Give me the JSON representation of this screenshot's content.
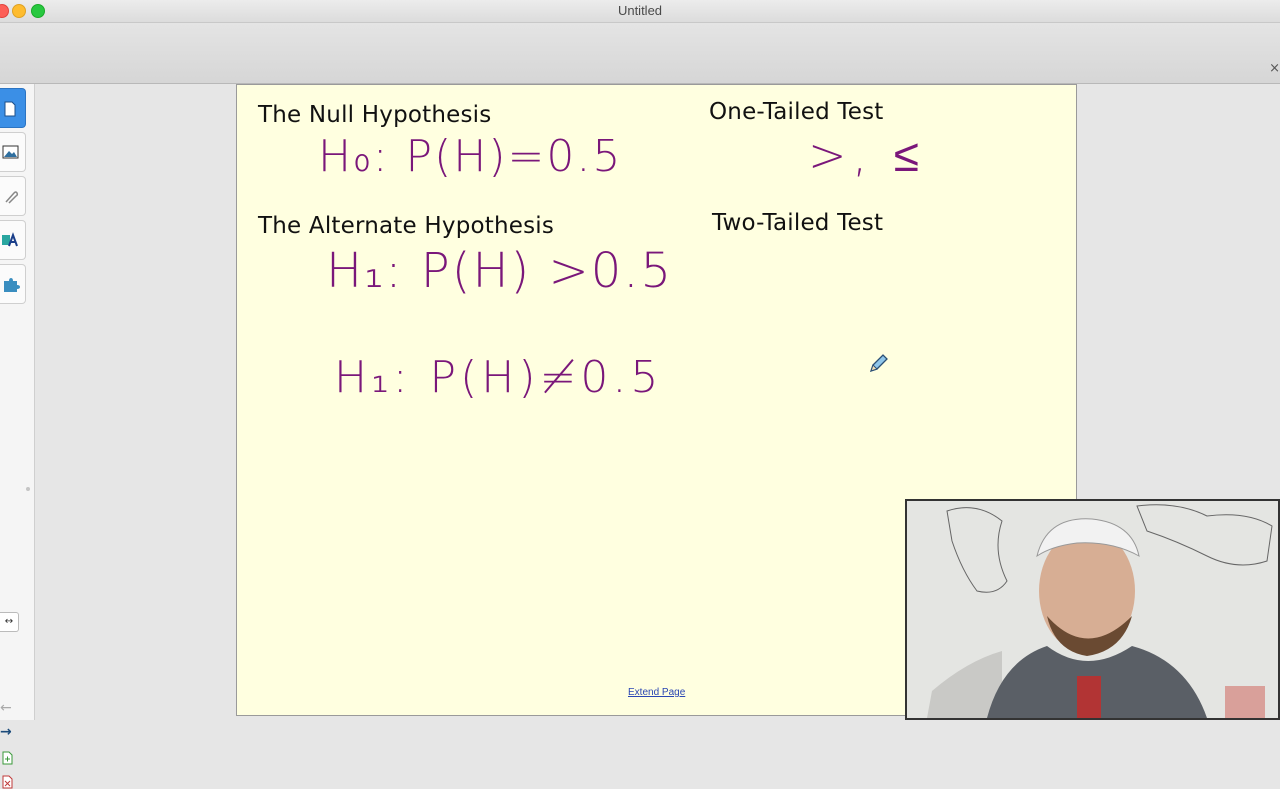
{
  "window": {
    "title": "Untitled",
    "close_glyph": "×"
  },
  "sidebar": {
    "tabs": [
      {
        "icon": "page-sorter-icon",
        "active": true
      },
      {
        "icon": "gallery-icon",
        "active": false
      },
      {
        "icon": "attachments-icon",
        "active": false
      },
      {
        "icon": "properties-icon",
        "active": false
      },
      {
        "icon": "addons-puzzle-icon",
        "active": false
      }
    ],
    "expand_glyph": "↔",
    "back_glyph": "←",
    "forward_glyph": "→"
  },
  "page": {
    "background": "#ffffe0",
    "headings": {
      "null_hypothesis": "The Null Hypothesis",
      "alternate_hypothesis": "The Alternate Hypothesis",
      "one_tailed": "One-Tailed Test",
      "two_tailed": "Two-Tailed Test"
    },
    "ink": {
      "color": "#7a177a",
      "h0": "H₀: P(H)=0.5",
      "h1_greater": "H₁: P(H) >0.5",
      "h1_not_equal": "H₁: P(H)≠0.5",
      "one_tailed_symbols": ">, ≤"
    },
    "extend_page": "Extend Page"
  }
}
